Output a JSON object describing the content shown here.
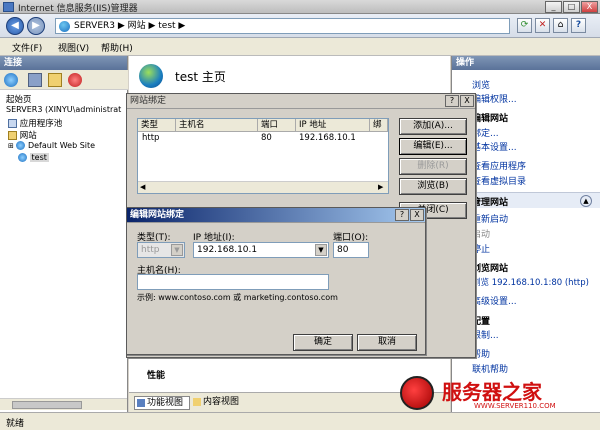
{
  "window": {
    "title": "Internet 信息服务(IIS)管理器",
    "min": "_",
    "max": "□",
    "close": "X"
  },
  "address": {
    "back": "◀",
    "forward": "▶",
    "breadcrumb": "SERVER3 ▶ 网站 ▶ test ▶",
    "help_button": "?"
  },
  "menu": [
    "文件(F)",
    "视图(V)",
    "帮助(H)"
  ],
  "connections": {
    "header": "连接",
    "tree": [
      "起始页",
      "SERVER3 (XINYU\\administrat",
      "应用程序池",
      "网站",
      "Default Web Site",
      "test"
    ]
  },
  "main": {
    "title": "test 主页",
    "section": "性能",
    "tabs": [
      "功能视图",
      "内容视图"
    ]
  },
  "actions": {
    "header": "操作",
    "items": [
      {
        "label": "浏览",
        "type": "link"
      },
      {
        "label": "编辑权限...",
        "type": "link"
      },
      {
        "label": "编辑网站",
        "type": "group"
      },
      {
        "label": "绑定...",
        "type": "link"
      },
      {
        "label": "基本设置...",
        "type": "link"
      },
      {
        "label": "查看应用程序",
        "type": "link"
      },
      {
        "label": "查看虚拟目录",
        "type": "link"
      },
      {
        "label": "管理网站",
        "type": "group"
      },
      {
        "label": "重新启动",
        "type": "link"
      },
      {
        "label": "启动",
        "type": "disabled"
      },
      {
        "label": "停止",
        "type": "link"
      },
      {
        "label": "浏览网站",
        "type": "group"
      },
      {
        "label": "浏览 192.168.10.1:80 (http)",
        "type": "link"
      },
      {
        "label": "高级设置...",
        "type": "link"
      },
      {
        "label": "配置",
        "type": "group"
      },
      {
        "label": "限制...",
        "type": "link"
      },
      {
        "label": "帮助",
        "type": "link"
      },
      {
        "label": "联机帮助",
        "type": "link"
      }
    ]
  },
  "site_bindings": {
    "title": "网站绑定",
    "help": "?",
    "close": "X",
    "columns": [
      "类型",
      "主机名",
      "端口",
      "IP 地址",
      "绑定"
    ],
    "rows": [
      {
        "type": "http",
        "host": "",
        "port": "80",
        "ip": "192.168.10.1",
        "binding": ""
      }
    ],
    "buttons": {
      "add": "添加(A)...",
      "edit": "编辑(E)...",
      "remove": "删除(R)",
      "browse": "浏览(B)",
      "close": "关闭(C)"
    }
  },
  "edit_binding": {
    "title": "编辑网站绑定",
    "help": "?",
    "close": "X",
    "type_label": "类型(T):",
    "type_value": "http",
    "ip_label": "IP 地址(I):",
    "ip_value": "192.168.10.1",
    "port_label": "端口(O):",
    "port_value": "80",
    "host_label": "主机名(H):",
    "host_value": "",
    "example": "示例: www.contoso.com 或 marketing.contoso.com",
    "ok": "确定",
    "cancel": "取消"
  },
  "status": {
    "text": "就绪"
  },
  "watermark": {
    "brand": "服务器之家",
    "url": "WWW.SERVER110.COM"
  },
  "colors": {
    "title_active": "#0a246a",
    "link": "#0033a0",
    "pane_header": "#5a7299",
    "watermark_red": "#d01010"
  }
}
